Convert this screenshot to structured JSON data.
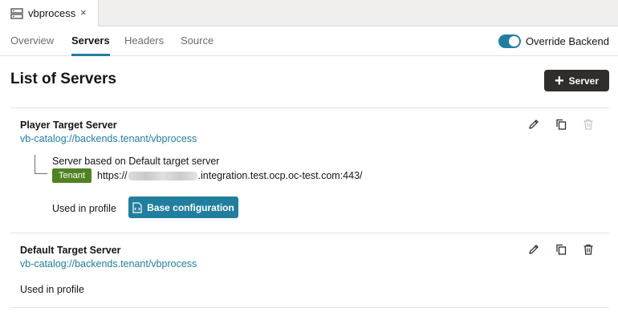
{
  "document_tab": {
    "title": "vbprocess",
    "close": "×",
    "icon": "server-icon"
  },
  "subnav": {
    "tabs": [
      {
        "label": "Overview"
      },
      {
        "label": "Servers",
        "active": true
      },
      {
        "label": "Headers"
      },
      {
        "label": "Source"
      }
    ],
    "override": {
      "label": "Override Backend",
      "enabled": true
    }
  },
  "page": {
    "title": "List of Servers",
    "add_button": {
      "plus": "+",
      "label": "Server"
    }
  },
  "servers": [
    {
      "name": "Player Target Server",
      "link": "vb-catalog://backends.tenant/vbprocess",
      "based_on": "Server based on Default target server",
      "badge": "Tenant",
      "url_prefix": "https://",
      "url_suffix": ".integration.test.ocp.oc-test.com:443/",
      "used_in": "Used in profile",
      "profile_button": "Base configuration",
      "delete_enabled": false
    },
    {
      "name": "Default Target Server",
      "link": "vb-catalog://backends.tenant/vbprocess",
      "used_in": "Used in profile",
      "delete_enabled": true
    }
  ],
  "colors": {
    "accent": "#227e9e",
    "badge": "#508223",
    "dark_button": "#312d2a"
  }
}
